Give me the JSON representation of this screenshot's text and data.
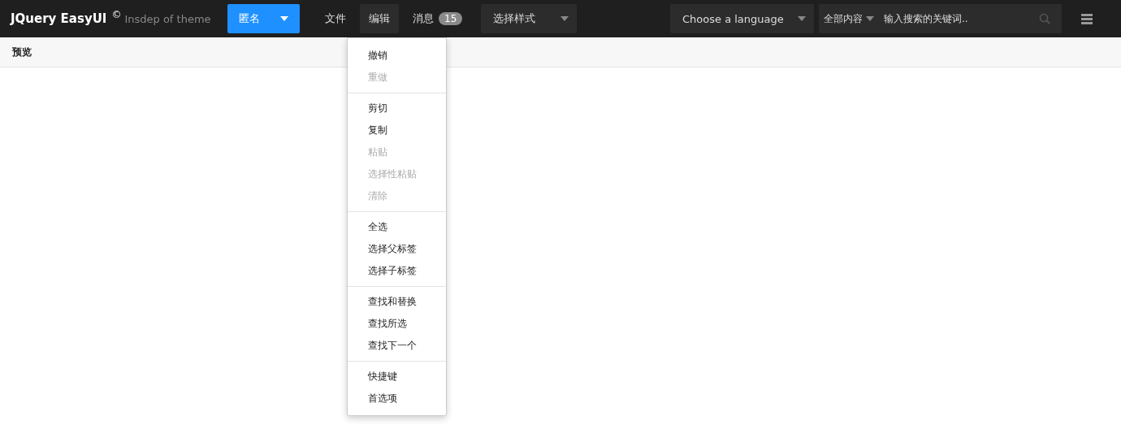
{
  "topbar": {
    "logo": "JQuery EasyUI",
    "logo_mark": "©",
    "subtitle": "Insdep of theme",
    "user_button": {
      "label": "匿名"
    },
    "nav": [
      {
        "label": "文件",
        "selected": false
      },
      {
        "label": "编辑",
        "selected": true
      },
      {
        "label": "消息",
        "selected": false,
        "badge": "15"
      }
    ],
    "style_select": {
      "value": "选择样式"
    },
    "language_select": {
      "value": "Choose a language"
    },
    "search": {
      "scope": "全部内容",
      "placeholder": "输入搜索的关键词.."
    }
  },
  "subbar": {
    "title": "预览"
  },
  "edit_menu": {
    "groups": [
      [
        {
          "label": "撤销",
          "disabled": false
        },
        {
          "label": "重做",
          "disabled": true
        }
      ],
      [
        {
          "label": "剪切",
          "disabled": false
        },
        {
          "label": "复制",
          "disabled": false
        },
        {
          "label": "粘贴",
          "disabled": true
        },
        {
          "label": "选择性粘贴",
          "disabled": true
        },
        {
          "label": "清除",
          "disabled": true
        }
      ],
      [
        {
          "label": "全选",
          "disabled": false
        },
        {
          "label": "选择父标签",
          "disabled": false
        },
        {
          "label": "选择子标签",
          "disabled": false
        }
      ],
      [
        {
          "label": "查找和替换",
          "disabled": false
        },
        {
          "label": "查找所选",
          "disabled": false
        },
        {
          "label": "查找下一个",
          "disabled": false
        }
      ],
      [
        {
          "label": "快捷键",
          "disabled": false
        },
        {
          "label": "首选项",
          "disabled": false
        }
      ]
    ]
  }
}
